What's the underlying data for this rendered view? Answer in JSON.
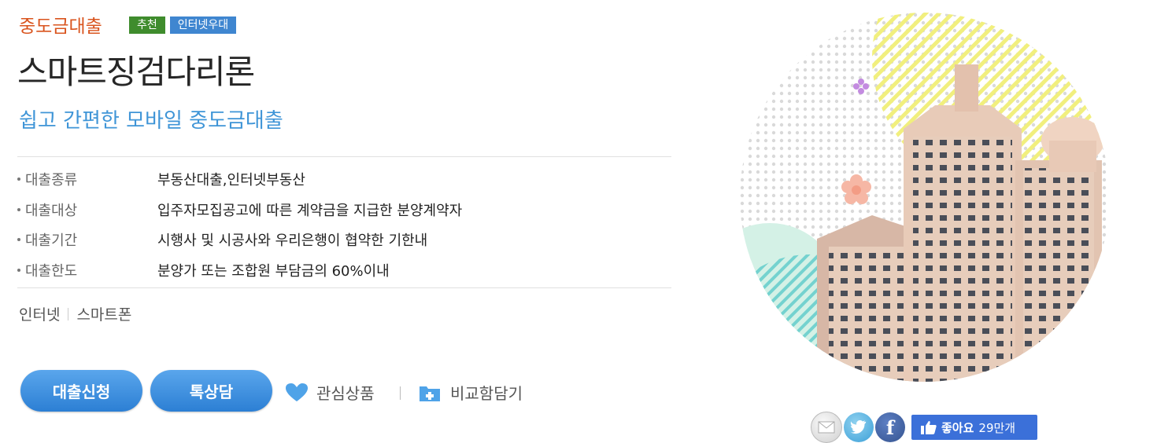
{
  "product": {
    "category": "중도금대출",
    "badges": [
      "추천",
      "인터넷우대"
    ],
    "name": "스마트징검다리론",
    "tagline": "쉽고 간편한 모바일 중도금대출"
  },
  "details": [
    {
      "label": "대출종류",
      "value": "부동산대출,인터넷부동산"
    },
    {
      "label": "대출대상",
      "value": "입주자모집공고에 따른 계약금을 지급한 분양계약자"
    },
    {
      "label": "대출기간",
      "value": "시행사 및 시공사와 우리은행이 협약한 기한내"
    },
    {
      "label": "대출한도",
      "value": "분양가 또는 조합원 부담금의 60%이내"
    }
  ],
  "channels": [
    "인터넷",
    "스마트폰"
  ],
  "actions": {
    "apply": "대출신청",
    "consult": "톡상담",
    "favorite": "관심상품",
    "compare": "비교함담기"
  },
  "social": {
    "icons": [
      "mail-icon",
      "twitter-icon",
      "facebook-icon"
    ],
    "facebook_letter": "f",
    "like_label": "좋아요",
    "like_count": "29만개"
  },
  "colors": {
    "category": "#d9541e",
    "badge_green": "#3f8c2d",
    "badge_blue": "#3f86d0",
    "tagline": "#3f95d7",
    "button": "#3a8de0",
    "like": "#3b70d9"
  }
}
